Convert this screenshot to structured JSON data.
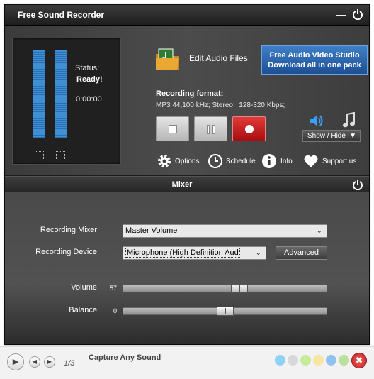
{
  "window": {
    "title": "Free Sound Recorder",
    "icons": [
      "minimize-icon",
      "power-icon"
    ]
  },
  "status": {
    "label": "Status:",
    "value": "Ready!",
    "time": "0:00:00",
    "meter_left_level": 1.0,
    "meter_right_level": 1.0
  },
  "edit_audio_label": "Edit Audio Files",
  "promo": {
    "line1": "Free Audio Video Studio",
    "line2": "Download all in one pack"
  },
  "recording_format": {
    "label": "Recording format:",
    "value": "MP3 44,100 kHz; Stereo;  128-320 Kbps;"
  },
  "controls": [
    "stop-button",
    "pause-button",
    "record-button"
  ],
  "show_hide_label": "Show / Hide",
  "links": {
    "options": "Options",
    "schedule": "Schedule",
    "info": "Info",
    "support": "Support us"
  },
  "mixer": {
    "title": "Mixer",
    "recording_mixer_label": "Recording Mixer",
    "recording_mixer_value": "Master Volume",
    "recording_device_label": "Recording Device",
    "recording_device_value": "Microphone (High Definition Aud",
    "advanced_label": "Advanced",
    "volume_label": "Volume",
    "volume_value": "57",
    "volume_level": 0.57,
    "balance_label": "Balance",
    "balance_value": "0",
    "balance_level": 0.5
  },
  "footer": {
    "pager": "1/3",
    "caption": "Capture Any Sound",
    "dot_colors": [
      "#8fd0f5",
      "#d8d8d8",
      "#c6ec9a",
      "#f7e6a0",
      "#8fc3ee",
      "#b9e19b"
    ]
  }
}
